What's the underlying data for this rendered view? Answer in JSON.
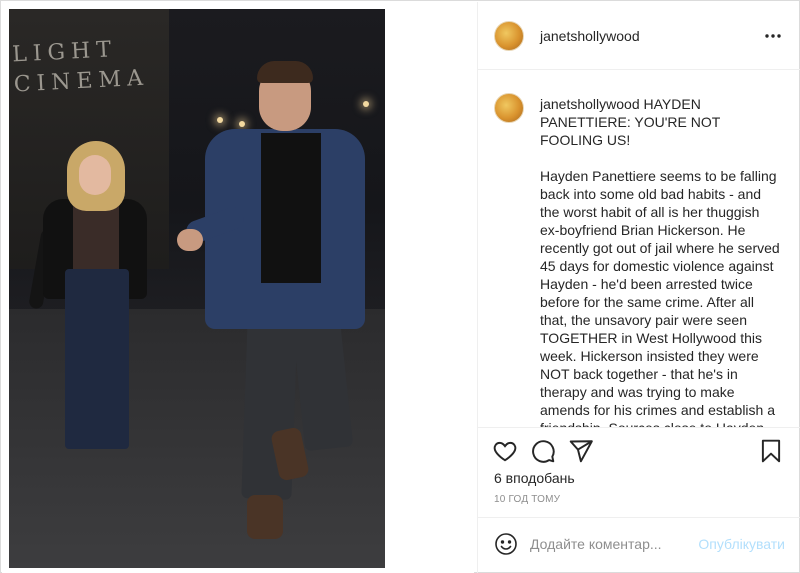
{
  "post": {
    "author": "janetshollywood",
    "menu_icon": "more-horizontal-icon",
    "photo_sign_text": "LIGHT\nCINEMA",
    "caption_author": "janetshollywood",
    "caption_text": " HAYDEN PANETTIERE: YOU'RE NOT FOOLING US!\n\nHayden Panettiere seems to be falling back into some old bad habits - and the worst habit of all is her thuggish ex-boyfriend Brian Hickerson. He recently got out of jail where he served 45 days for domestic violence against Hayden - he'd been arrested twice before for the same crime. After all that, the unsavory pair were seen TOGETHER in West Hollywood this week. Hickerson insisted they were NOT back together - that he's in therapy and was trying to make amends for his crimes and establish a friendship. Sources close to Hayden insist"
  },
  "actions": {
    "like_icon": "heart-icon",
    "comment_icon": "comment-icon",
    "share_icon": "send-icon",
    "save_icon": "bookmark-icon"
  },
  "stats": {
    "likes": "6 вподобань",
    "timestamp": "10 ГОД ТОМУ"
  },
  "comment": {
    "emoji_icon": "emoji-icon",
    "placeholder": "Додайте коментар...",
    "publish_label": "Опублікувати"
  },
  "colors": {
    "text": "#262626",
    "muted": "#8e8e8e",
    "border": "#dbdbdb",
    "publish_disabled": "#b2dffc"
  }
}
